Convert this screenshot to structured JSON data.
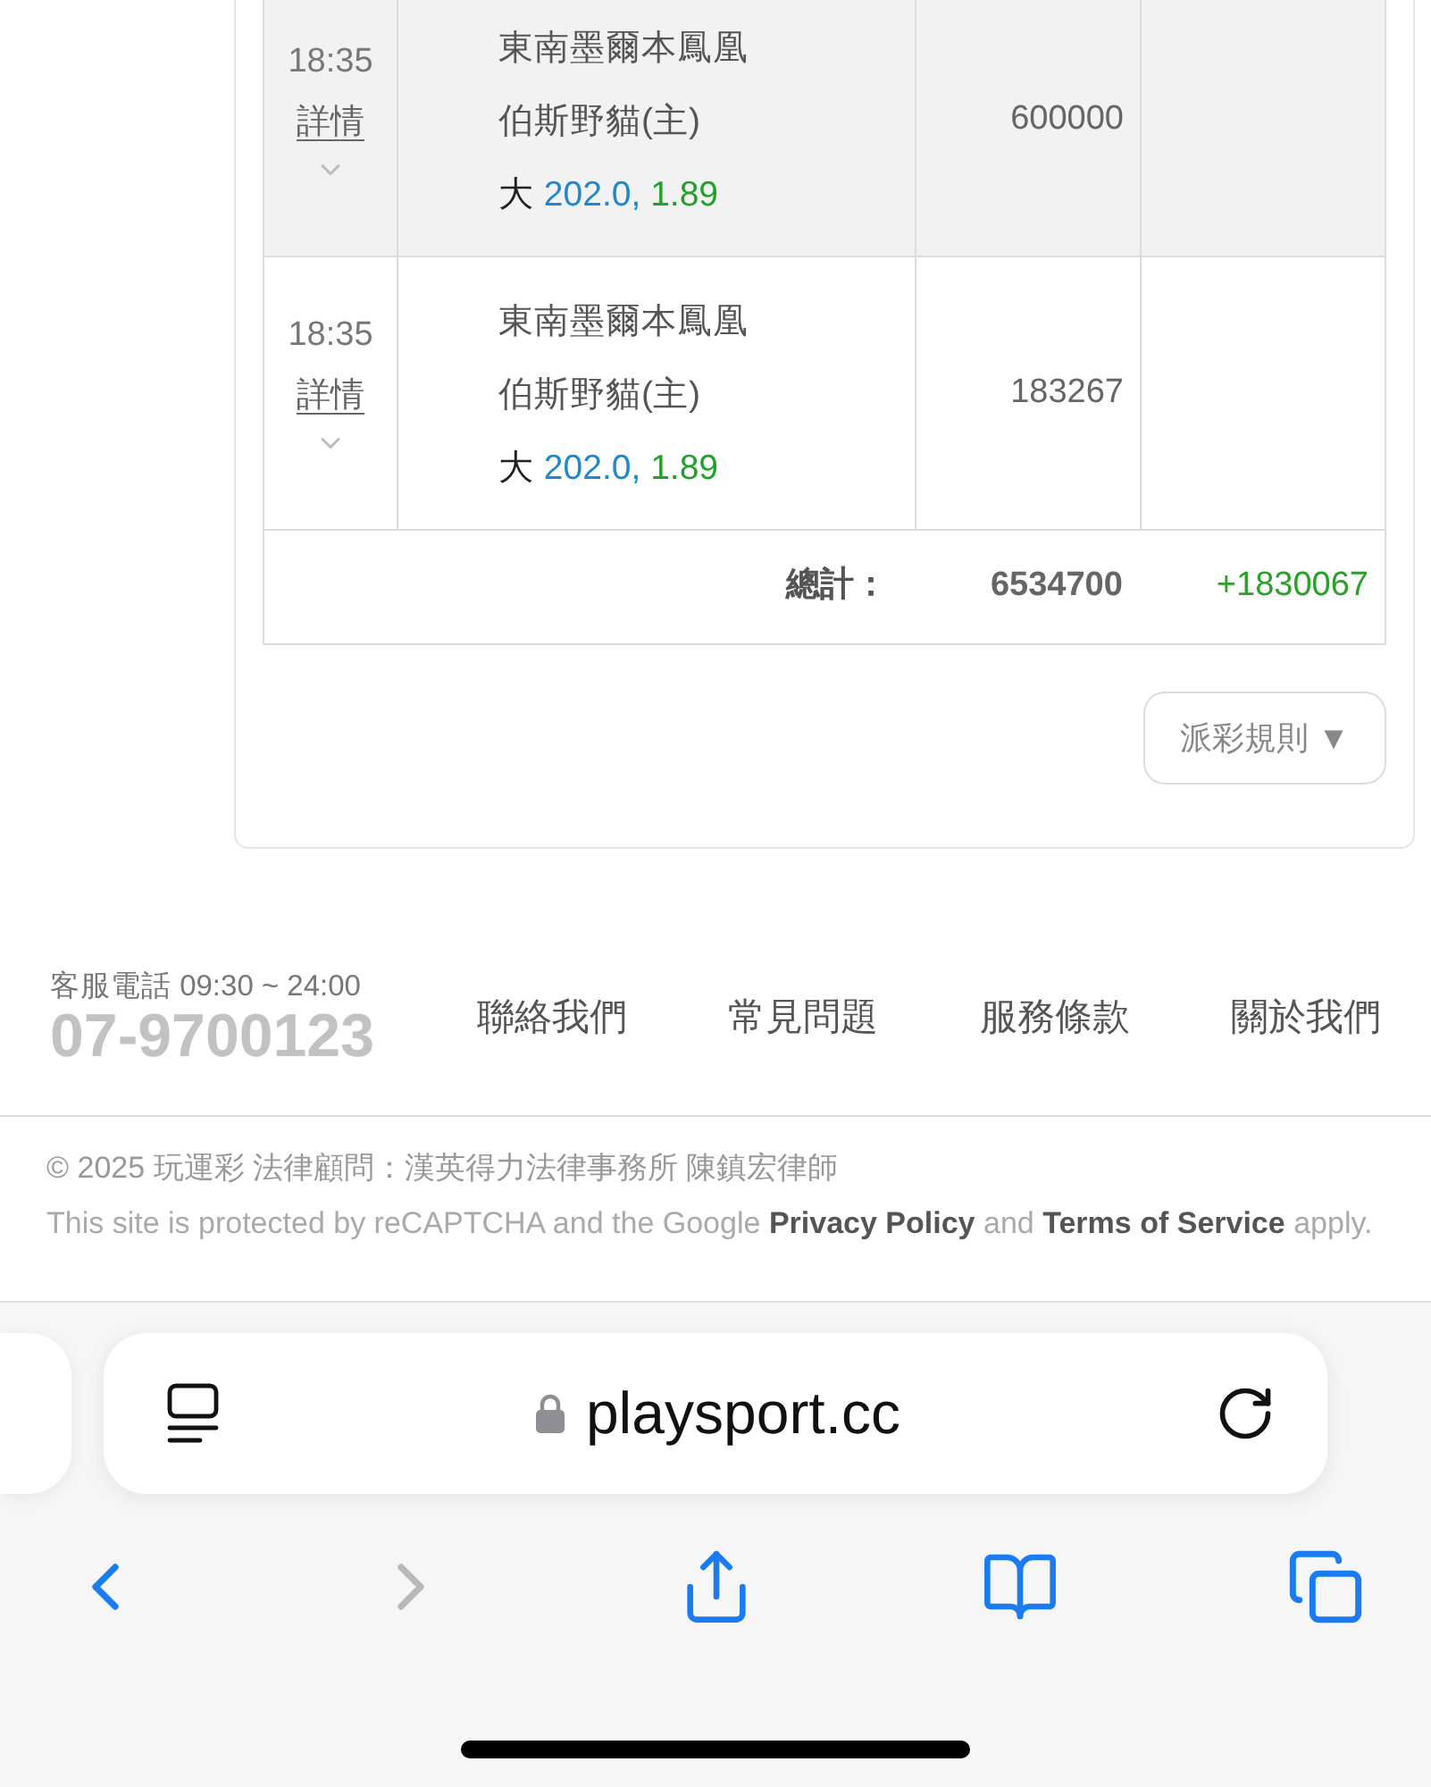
{
  "bets_table": {
    "rows": [
      {
        "time": "18:35",
        "details": "詳情",
        "expanded": false,
        "home_team": "東南墨爾本鳳凰",
        "away_team": "伯斯野貓(主)",
        "pick": "大",
        "line": "202.0,",
        "odds": "1.89",
        "stake": "600000"
      },
      {
        "time": "18:35",
        "details": "詳情",
        "expanded": false,
        "home_team": "東南墨爾本鳳凰",
        "away_team": "伯斯野貓(主)",
        "pick": "大",
        "line": "202.0,",
        "odds": "1.89",
        "stake": "183267"
      }
    ],
    "total": {
      "label": "總計：",
      "stake": "6534700",
      "result": "+1830067"
    }
  },
  "payout_rules_button": {
    "label": "派彩規則",
    "caret": "▼"
  },
  "footer": {
    "hotline": "客服電話 09:30 ~ 24:00",
    "phone": "07-9700123",
    "links": [
      "聯絡我們",
      "常見問題",
      "服務條款",
      "關於我們"
    ],
    "copyright": "© 2025 玩運彩 法律顧問：漢英得力法律事務所 陳鎮宏律師",
    "recaptcha": {
      "before": "This site is protected by reCAPTCHA and the Google",
      "privacy_link": "Privacy Policy",
      "middle": "and",
      "terms_link": "Terms of Service",
      "after": "apply."
    }
  },
  "browser": {
    "url": "playsport.cc",
    "back_disabled": false,
    "forward_disabled": true
  }
}
